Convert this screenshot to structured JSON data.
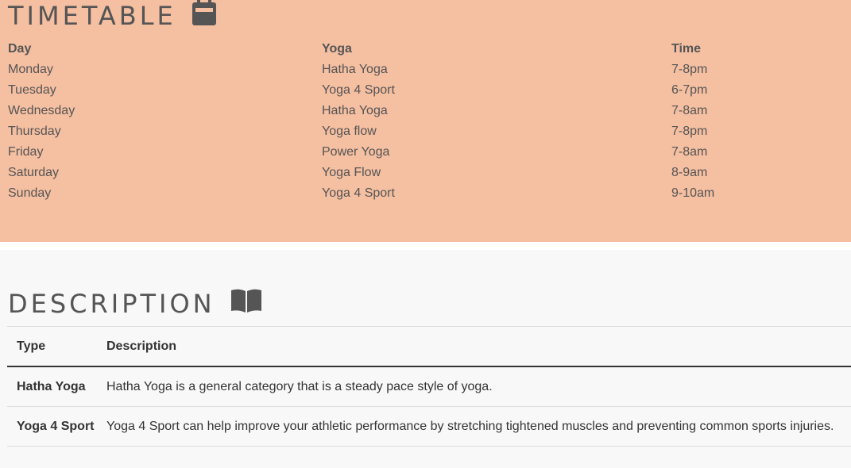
{
  "timetable": {
    "title": "TIMETABLE",
    "icon": "calendar-icon",
    "headers": {
      "day": "Day",
      "yoga": "Yoga",
      "time": "Time"
    },
    "rows": [
      {
        "day": "Monday",
        "yoga": "Hatha Yoga",
        "time": "7-8pm"
      },
      {
        "day": "Tuesday",
        "yoga": "Yoga 4 Sport",
        "time": "6-7pm"
      },
      {
        "day": "Wednesday",
        "yoga": "Hatha Yoga",
        "time": "7-8am"
      },
      {
        "day": "Thursday",
        "yoga": "Yoga flow",
        "time": "7-8pm"
      },
      {
        "day": "Friday",
        "yoga": "Power Yoga",
        "time": "7-8am"
      },
      {
        "day": "Saturday",
        "yoga": "Yoga Flow",
        "time": "8-9am"
      },
      {
        "day": "Sunday",
        "yoga": "Yoga 4 Sport",
        "time": "9-10am"
      }
    ],
    "background_color": "#f5bfa1"
  },
  "description": {
    "title": "DESCRIPTION",
    "icon": "book-icon",
    "headers": {
      "type": "Type",
      "description": "Description"
    },
    "rows": [
      {
        "type": "Hatha Yoga",
        "description": "Hatha Yoga is a general category that is a steady pace style of yoga."
      },
      {
        "type": "Yoga 4 Sport",
        "description": "Yoga 4 Sport can help improve your athletic performance by stretching tightened muscles and preventing common sports injuries."
      }
    ]
  },
  "colors": {
    "text": "#555555",
    "page_background": "#f8f8f8"
  }
}
